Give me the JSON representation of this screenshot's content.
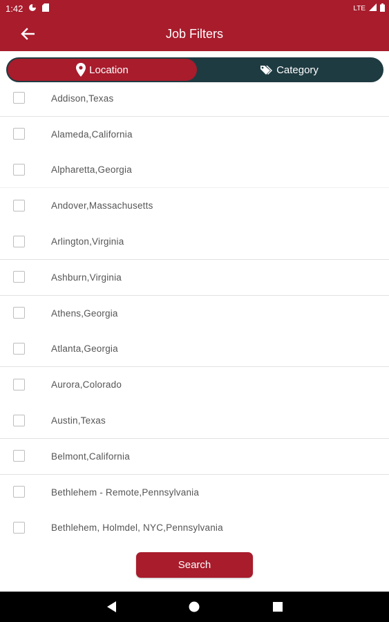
{
  "status_bar": {
    "time": "1:42",
    "network": "LTE"
  },
  "header": {
    "title": "Job Filters"
  },
  "tabs": {
    "location_label": "Location",
    "category_label": "Category"
  },
  "locations": [
    "Addison,Texas",
    "Alameda,California",
    "Alpharetta,Georgia",
    "Andover,Massachusetts",
    "Arlington,Virginia",
    "Ashburn,Virginia",
    "Athens,Georgia",
    "Atlanta,Georgia",
    "Aurora,Colorado",
    "Austin,Texas",
    "Belmont,California",
    "Bethlehem - Remote,Pennsylvania",
    "Bethlehem, Holmdel, NYC,Pennsylvania"
  ],
  "search_button": {
    "label": "Search"
  },
  "colors": {
    "primary": "#a81c2c",
    "tab_bar": "#1f3b42"
  }
}
